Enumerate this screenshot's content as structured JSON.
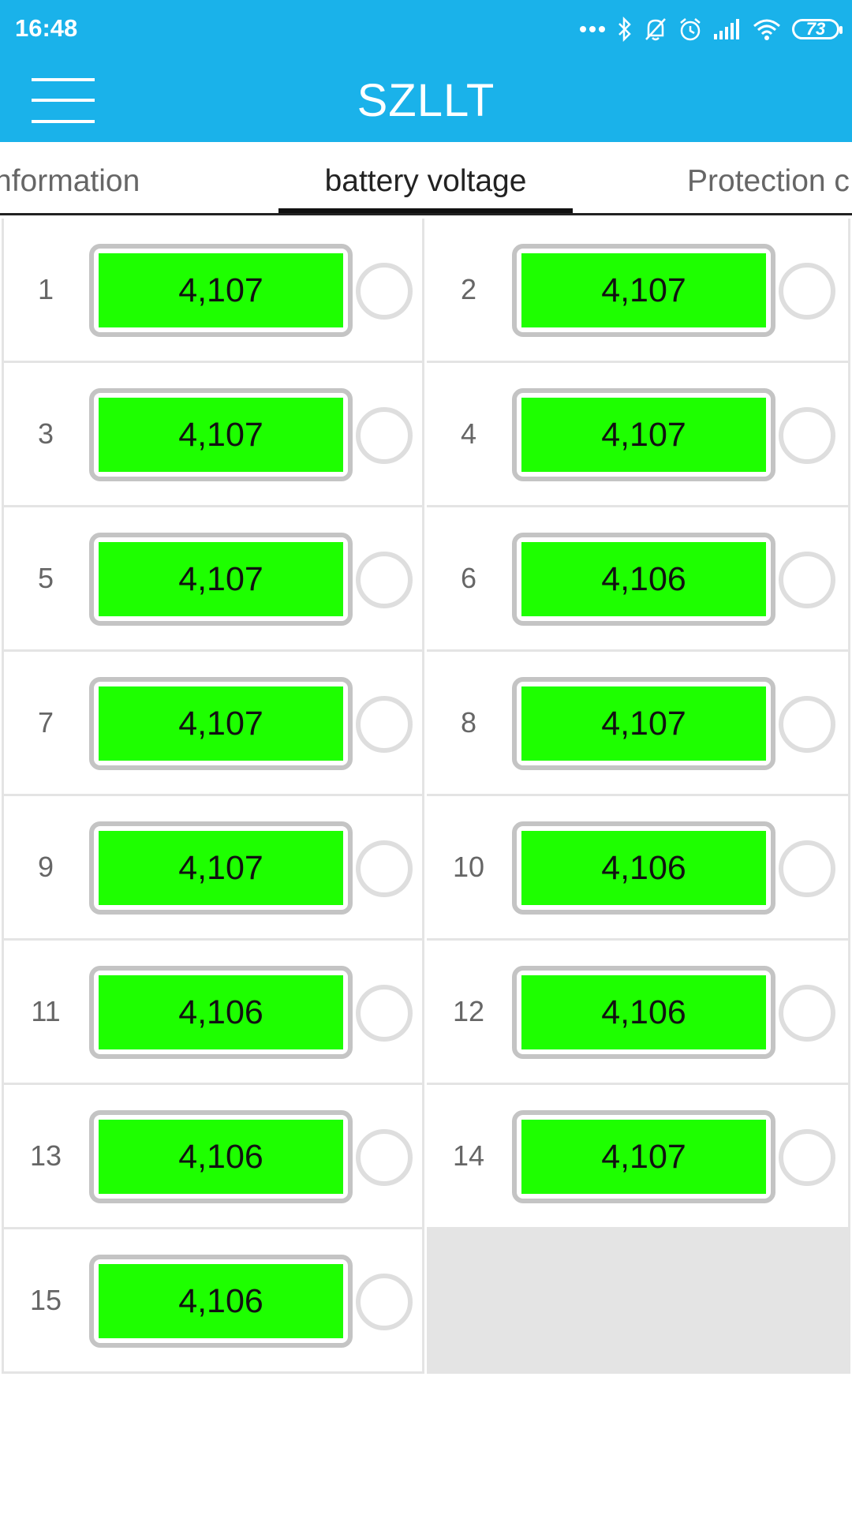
{
  "status_bar": {
    "time": "16:48",
    "battery_level": "73"
  },
  "app_bar": {
    "title": "SZLLT"
  },
  "tabs": [
    {
      "label": "nformation"
    },
    {
      "label": "battery voltage",
      "selected": true
    },
    {
      "label": "Protection c"
    }
  ],
  "cells": [
    {
      "number": "1",
      "voltage": "4,107"
    },
    {
      "number": "2",
      "voltage": "4,107"
    },
    {
      "number": "3",
      "voltage": "4,107"
    },
    {
      "number": "4",
      "voltage": "4,107"
    },
    {
      "number": "5",
      "voltage": "4,107"
    },
    {
      "number": "6",
      "voltage": "4,106"
    },
    {
      "number": "7",
      "voltage": "4,107"
    },
    {
      "number": "8",
      "voltage": "4,107"
    },
    {
      "number": "9",
      "voltage": "4,107"
    },
    {
      "number": "10",
      "voltage": "4,106"
    },
    {
      "number": "11",
      "voltage": "4,106"
    },
    {
      "number": "12",
      "voltage": "4,106"
    },
    {
      "number": "13",
      "voltage": "4,106"
    },
    {
      "number": "14",
      "voltage": "4,107"
    },
    {
      "number": "15",
      "voltage": "4,106"
    }
  ],
  "colors": {
    "accent": "#1ab2ea",
    "cell_fill": "#1eff00",
    "cell_border": "#c4c4c4",
    "grid_line": "#e4e4e4"
  },
  "icons": [
    "more-dots-icon",
    "bluetooth-icon",
    "bell-off-icon",
    "alarm-icon",
    "signal-icon",
    "wifi-icon",
    "battery-icon",
    "menu-icon"
  ]
}
